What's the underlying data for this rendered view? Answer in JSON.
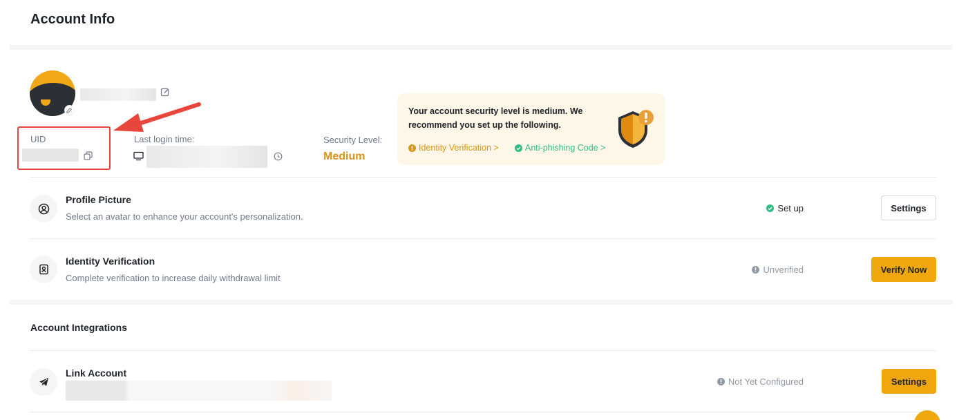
{
  "page": {
    "title": "Account Info"
  },
  "profile": {
    "uid_label": "UID",
    "last_login_label": "Last login time:",
    "security_level_label": "Security Level:",
    "security_level_value": "Medium"
  },
  "security_tip": {
    "message": "Your account security level is medium. We recommend you set up the following.",
    "link_identity": "Identity Verification >",
    "link_antiphishing": "Anti-phishing Code >"
  },
  "rows": [
    {
      "title": "Profile Picture",
      "description": "Select an avatar to enhance your account's personalization.",
      "status": "Set up",
      "button": "Settings",
      "icon": "user-circle-icon"
    },
    {
      "title": "Identity Verification",
      "description": "Complete verification to increase daily withdrawal limit",
      "status": "Unverified",
      "button": "Verify Now",
      "icon": "id-badge-icon"
    }
  ],
  "integrations": {
    "title": "Account Integrations",
    "rows": [
      {
        "title": "Link Account",
        "status": "Not Yet Configured",
        "button": "Settings",
        "icon": "telegram-icon"
      }
    ]
  },
  "colors": {
    "accent": "#f0a70e",
    "medium": "#d89614",
    "success": "#2ebd85",
    "annotation": "#e8453c"
  }
}
